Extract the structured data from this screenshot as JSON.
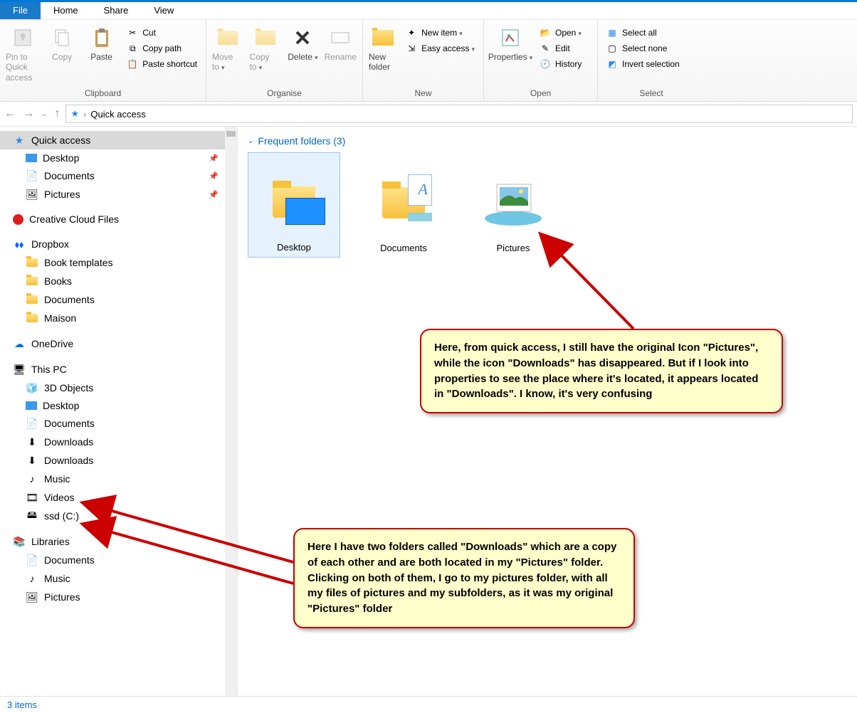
{
  "topline": true,
  "tabs": {
    "file": "File",
    "home": "Home",
    "share": "Share",
    "view": "View"
  },
  "ribbon": {
    "clipboard": {
      "label": "Clipboard",
      "pin": "Pin to Quick access",
      "copy": "Copy",
      "paste": "Paste",
      "cut": "Cut",
      "copy_path": "Copy path",
      "paste_shortcut": "Paste shortcut"
    },
    "organise": {
      "label": "Organise",
      "move_to": "Move to",
      "copy_to": "Copy to",
      "delete": "Delete",
      "rename": "Rename"
    },
    "new": {
      "label": "New",
      "new_folder": "New folder",
      "new_item": "New item",
      "easy_access": "Easy access"
    },
    "open": {
      "label": "Open",
      "properties": "Properties",
      "open": "Open",
      "edit": "Edit",
      "history": "History"
    },
    "select": {
      "label": "Select",
      "select_all": "Select all",
      "select_none": "Select none",
      "invert": "Invert selection"
    }
  },
  "breadcrumb": {
    "root": "Quick access"
  },
  "tree": {
    "quick_access": "Quick access",
    "qa_items": [
      {
        "label": "Desktop",
        "pin": true
      },
      {
        "label": "Documents",
        "pin": true
      },
      {
        "label": "Pictures",
        "pin": true
      }
    ],
    "groups": [
      {
        "label": "Creative Cloud Files",
        "icon": "cc"
      },
      {
        "label": "Dropbox",
        "icon": "dropbox",
        "children": [
          "Book templates",
          "Books",
          "Documents",
          "Maison"
        ]
      },
      {
        "label": "OneDrive",
        "icon": "onedrive"
      },
      {
        "label": "This PC",
        "icon": "pc",
        "children": [
          "3D Objects",
          "Desktop",
          "Documents",
          "Downloads",
          "Downloads",
          "Music",
          "Videos",
          "ssd (C:)"
        ]
      },
      {
        "label": "Libraries",
        "icon": "lib",
        "children": [
          "Documents",
          "Music",
          "Pictures"
        ]
      }
    ]
  },
  "content": {
    "section": "Frequent folders (3)",
    "folders": [
      {
        "label": "Desktop",
        "selected": true
      },
      {
        "label": "Documents",
        "selected": false
      },
      {
        "label": "Pictures",
        "selected": false
      }
    ]
  },
  "callout1": "Here, from quick access, I still have the original Icon \"Pictures\", while the icon \"Downloads\" has disappeared. But if I look into properties to see the place where it's located, it appears located in \"Downloads\". I know, it's very confusing",
  "callout2": "Here I have two folders called \"Downloads\" which are a copy of each other and are both located in my \"Pictures\" folder. Clicking on both of them, I go to my pictures folder, with all my files of pictures and my subfolders, as it was my original \"Pictures\" folder",
  "status": "3 items"
}
